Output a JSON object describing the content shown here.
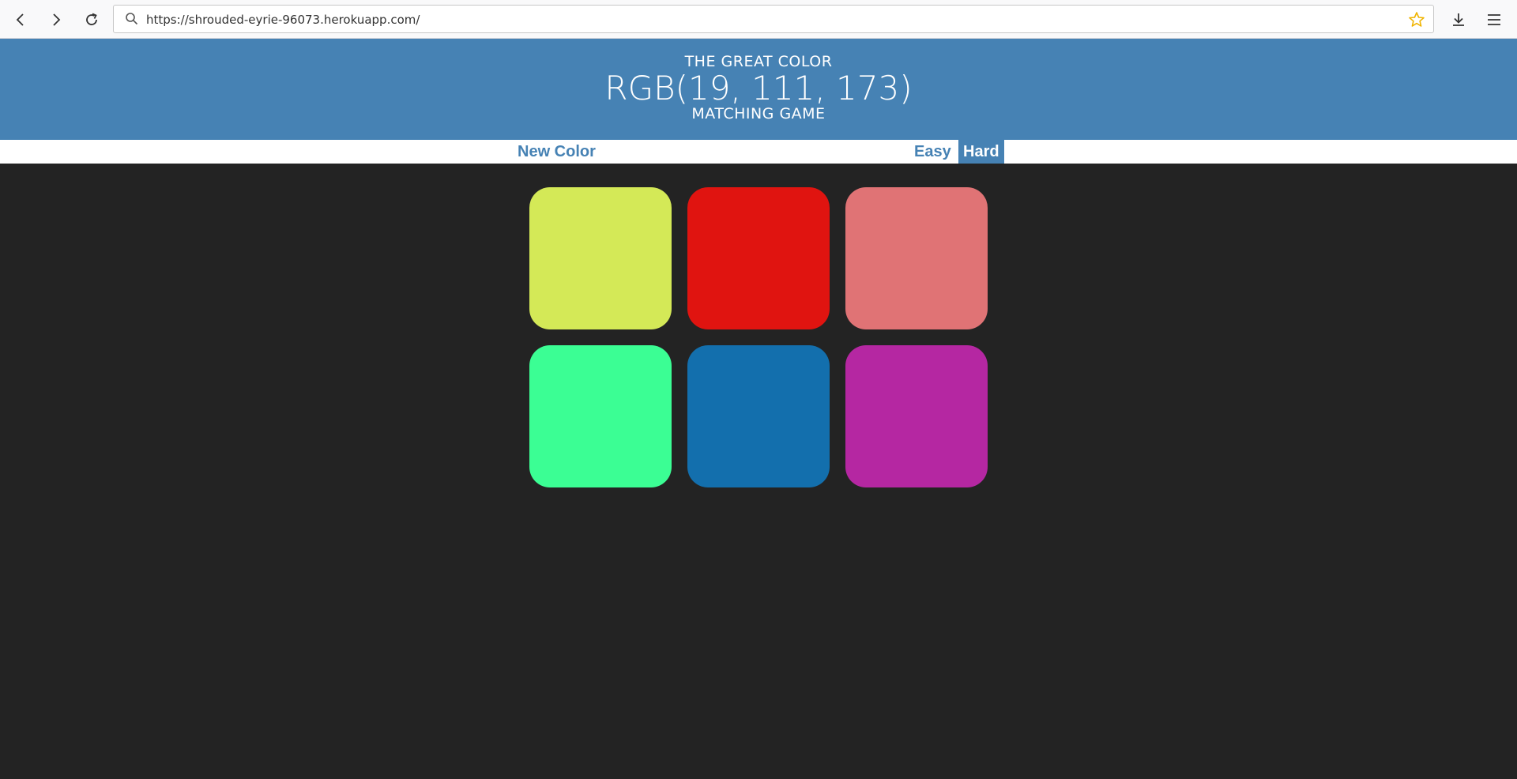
{
  "browser": {
    "url": "https://shrouded-eyrie-96073.herokuapp.com/"
  },
  "header": {
    "line1": "THE GREAT COLOR",
    "rgb": "RGB(19, 111, 173)",
    "line3": "MATCHING GAME",
    "color": "#4682b4"
  },
  "stripe": {
    "new_color": "New Color",
    "easy": "Easy",
    "hard": "Hard",
    "selected_mode": "Hard"
  },
  "squares": [
    {
      "color": "#d4e957"
    },
    {
      "color": "#e01410"
    },
    {
      "color": "#e07375"
    },
    {
      "color": "#3bfe94"
    },
    {
      "color": "#136fad"
    },
    {
      "color": "#b527a2"
    }
  ]
}
